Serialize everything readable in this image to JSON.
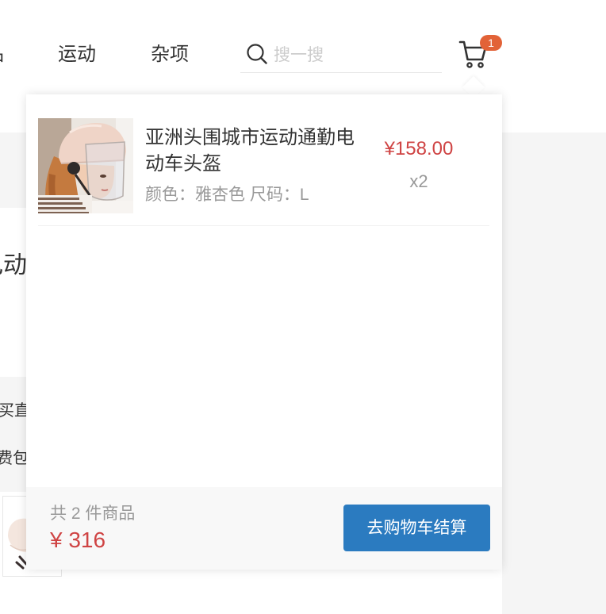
{
  "header": {
    "nav": [
      {
        "label": "品"
      },
      {
        "label": "运动"
      },
      {
        "label": "杂项"
      }
    ],
    "search": {
      "placeholder": "搜一搜",
      "icon": "search-icon"
    },
    "cart": {
      "icon": "cart-icon",
      "badge": "1"
    }
  },
  "detail": {
    "title": "电动",
    "promo_lines": [
      "买直",
      "费包"
    ]
  },
  "mini_cart": {
    "items": [
      {
        "name": "亚洲头围城市运动通勤电动车头盔",
        "attrs": "颜色：雅杏色 尺码：L",
        "price": "¥158.00",
        "quantity": "x2"
      }
    ],
    "summary": {
      "count_text": "共 2 件商品",
      "total": "¥ 316"
    },
    "checkout_label": "去购物车结算"
  },
  "colors": {
    "price": "#cf4444",
    "button": "#2b7bc0",
    "badge": "#e26237",
    "page_bg": "#f5f5f5",
    "footer_bg": "#f8f8f8"
  }
}
